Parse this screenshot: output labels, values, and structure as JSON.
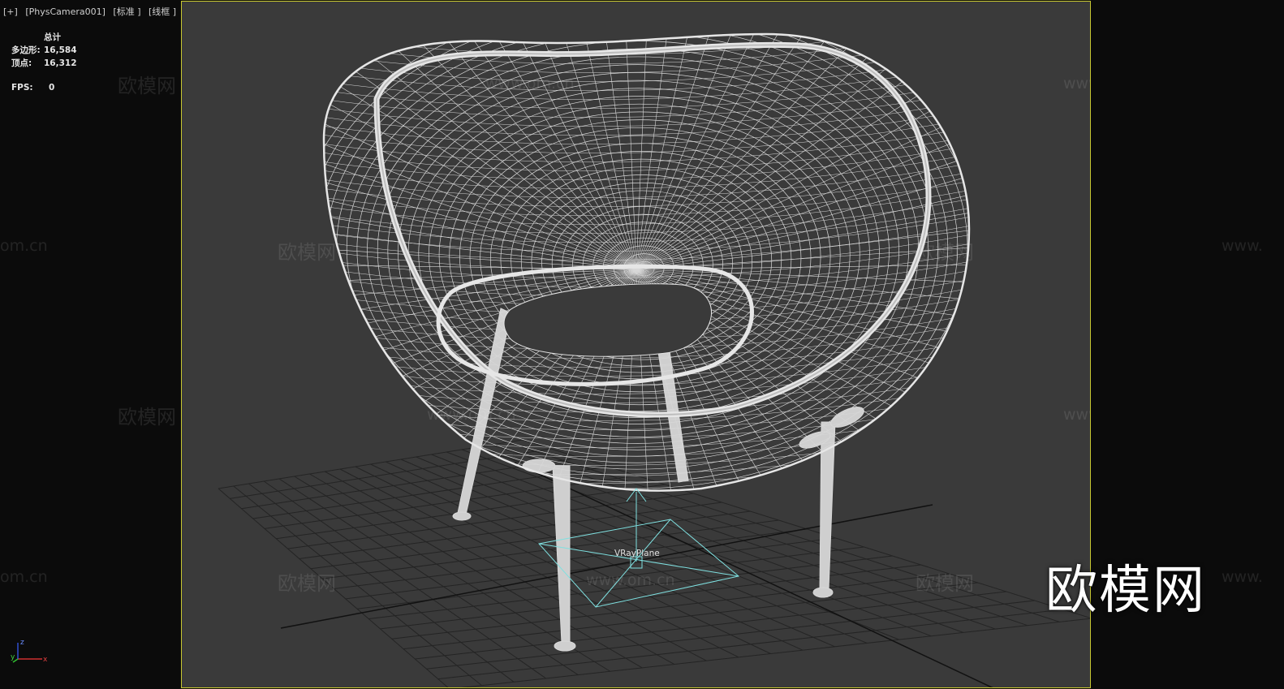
{
  "viewport": {
    "plus_label": "[+]",
    "camera_label": "[PhysCamera001]",
    "shading_label": "[标准 ]",
    "display_label": "[线框 ]"
  },
  "stats": {
    "header": "总计",
    "polys_label": "多边形:",
    "polys_value": "16,584",
    "verts_label": "顶点:",
    "verts_value": "16,312",
    "fps_label": "FPS:",
    "fps_value": "0"
  },
  "scene": {
    "object_label": "VRayPlane"
  },
  "watermarks": {
    "cn": "欧模网",
    "url": "www.om.cn",
    "url_partial": "om.cn",
    "url_prefix": "www."
  },
  "brand": {
    "text": "欧模网"
  },
  "gizmo": {
    "z": "z",
    "y": "y",
    "x": "x"
  },
  "colors": {
    "viewport_bg": "#3a3a3a",
    "viewport_border": "#c8c832",
    "wire": "#e0e0e0",
    "vray_plane": "#7fe0e0",
    "grid": "#2a2a2a"
  }
}
